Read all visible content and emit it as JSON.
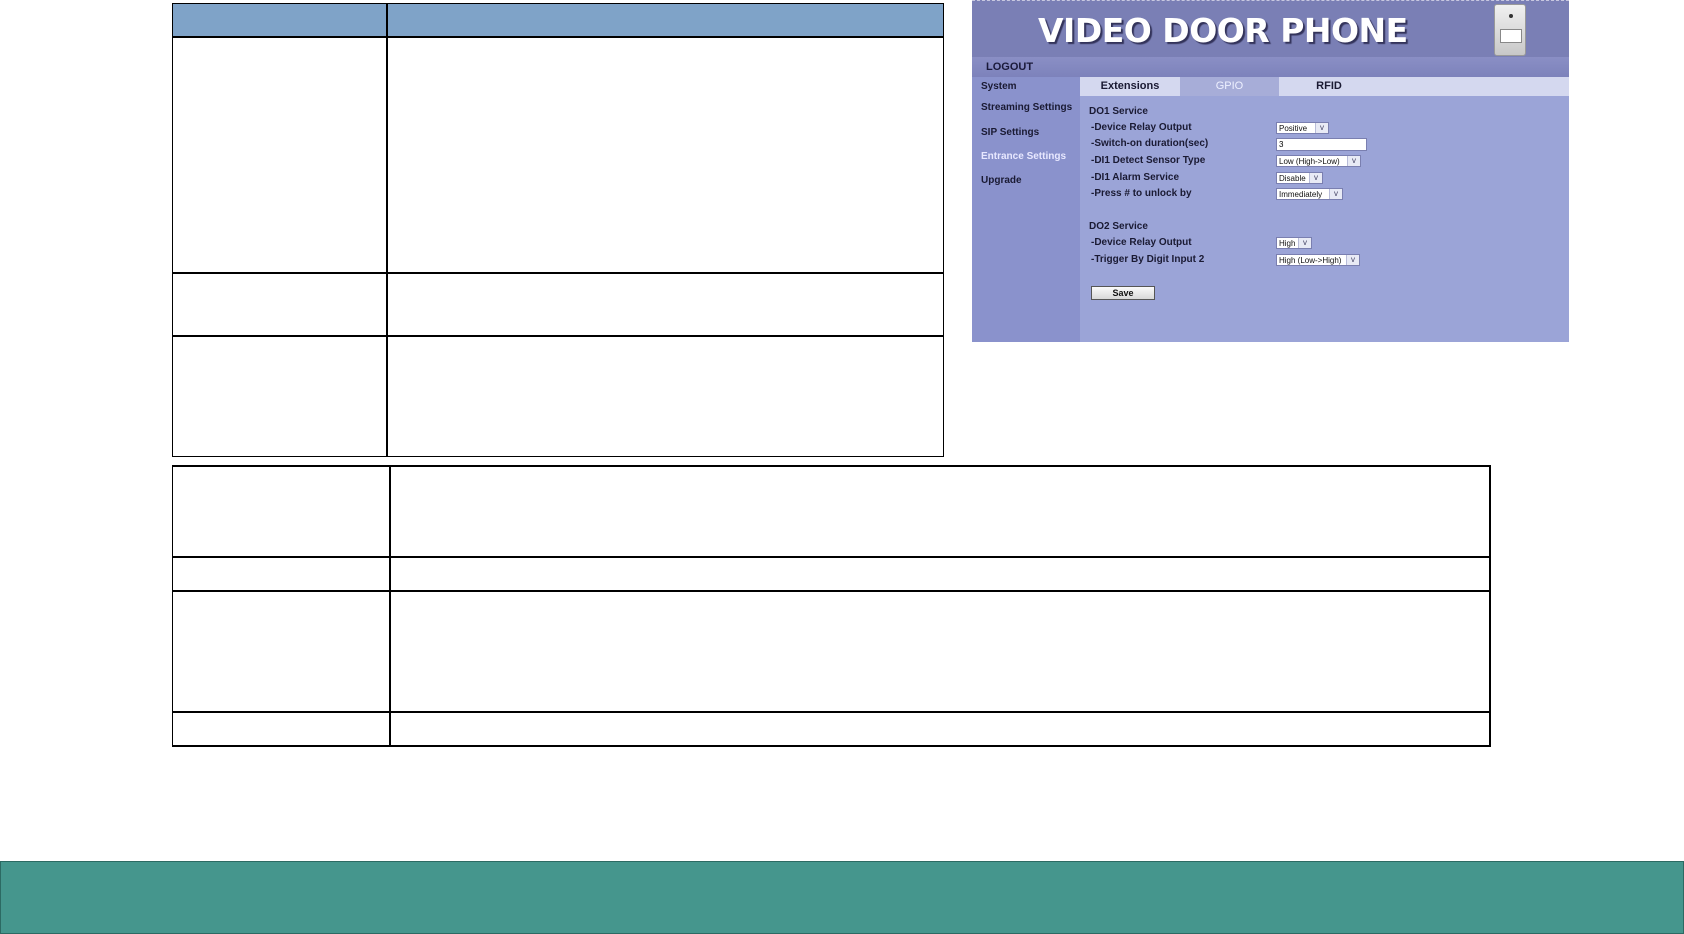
{
  "video_door_phone": {
    "title": "VIDEO DOOR PHONE",
    "logout": "LOGOUT",
    "sidebar": [
      {
        "label": "System",
        "active": false
      },
      {
        "label": "Streaming Settings",
        "active": false
      },
      {
        "label": "SIP Settings",
        "active": false
      },
      {
        "label": "Entrance Settings",
        "active": true
      },
      {
        "label": "Upgrade",
        "active": false
      }
    ],
    "tabs": [
      {
        "label": "Extensions",
        "active": false
      },
      {
        "label": "GPIO",
        "active": true
      },
      {
        "label": "RFID",
        "active": false
      }
    ],
    "do1": {
      "heading": "DO1 Service",
      "device_relay_output_label": "-Device Relay Output",
      "device_relay_output_value": "Positive",
      "switch_on_label": "-Switch-on duration(sec)",
      "switch_on_value": "3",
      "di1_sensor_label": "-DI1 Detect Sensor Type",
      "di1_sensor_value": "Low (High->Low)",
      "di1_alarm_label": "-DI1 Alarm Service",
      "di1_alarm_value": "Disable",
      "press_unlock_label": "-Press # to unlock by",
      "press_unlock_value": "Immediately"
    },
    "do2": {
      "heading": "DO2 Service",
      "device_relay_output_label": "-Device Relay Output",
      "device_relay_output_value": "High",
      "trigger_label": "-Trigger By Digit Input 2",
      "trigger_value": "High (Low->High)"
    },
    "save_label": "Save",
    "arrow_glyph": "v"
  },
  "colors": {
    "table_header": "#7fa3c8",
    "footer": "#45968d",
    "panel_bg": "#9ba4d7"
  }
}
